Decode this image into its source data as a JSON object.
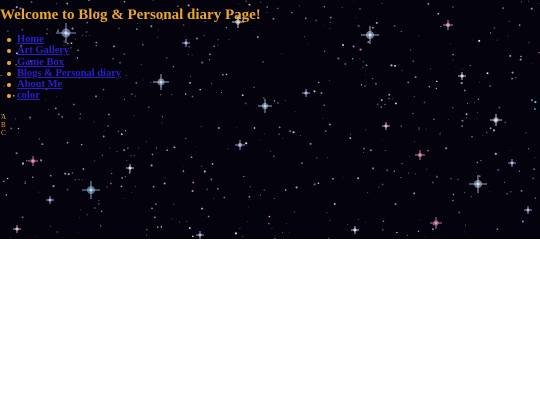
{
  "page": {
    "title": "Welcome to Blog & Personal diary Page!"
  },
  "nav": {
    "items": [
      {
        "label": "Home"
      },
      {
        "label": "Art Gallery"
      },
      {
        "label": "Game Box"
      },
      {
        "label": "Blogs & Personal diary"
      },
      {
        "label": "About Me"
      },
      {
        "label": "color"
      }
    ]
  },
  "letters": {
    "items": [
      "A",
      "B",
      "C"
    ]
  },
  "colors": {
    "title": "#e8a632",
    "link": "#2a1fc8",
    "background": "#04020c"
  }
}
